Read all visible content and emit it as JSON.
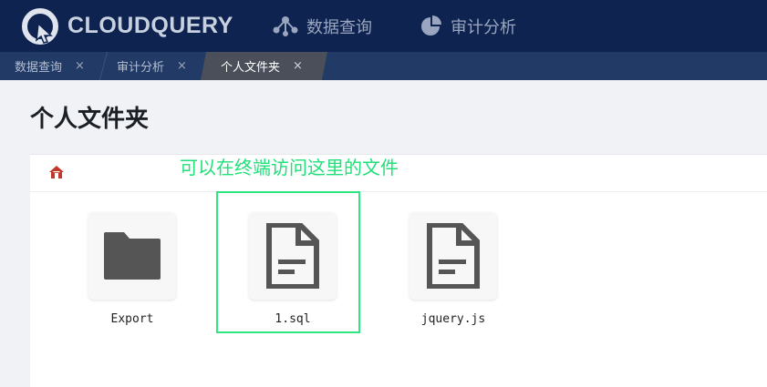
{
  "header": {
    "brand": "CLOUDQUERY",
    "nav": [
      {
        "label": "数据查询",
        "icon": "query-nodes-icon"
      },
      {
        "label": "审计分析",
        "icon": "pie-chart-icon"
      }
    ]
  },
  "tabs": [
    {
      "label": "数据查询",
      "close": "×",
      "active": false
    },
    {
      "label": "审计分析",
      "close": "×",
      "active": false
    },
    {
      "label": "个人文件夹",
      "close": "×",
      "active": true
    }
  ],
  "page": {
    "title": "个人文件夹",
    "annotation": "可以在终端访问这里的文件"
  },
  "files": [
    {
      "name": "Export",
      "type": "folder",
      "icon": "folder-icon"
    },
    {
      "name": "1.sql",
      "type": "file",
      "icon": "file-icon"
    },
    {
      "name": "jquery.js",
      "type": "file",
      "icon": "file-icon"
    }
  ],
  "colors": {
    "header_bg": "#0f2350",
    "tabbar_bg": "#213a66",
    "active_tab": "#4a4f5a",
    "annotation": "#21e07a",
    "icon": "#555555"
  }
}
